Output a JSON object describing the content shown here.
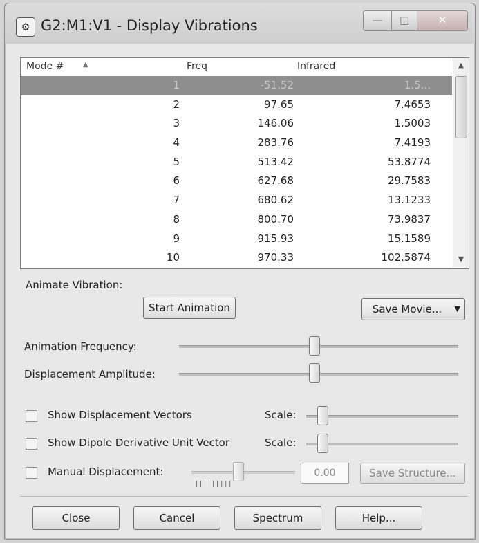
{
  "window": {
    "title": "G2:M1:V1 - Display Vibrations",
    "app_icon": "gaussview-app-icon"
  },
  "list": {
    "headers": [
      "Mode #",
      "Freq",
      "Infrared"
    ],
    "rows": [
      {
        "mode": "1",
        "freq": "-51.52",
        "ir": "1.5..."
      },
      {
        "mode": "2",
        "freq": "97.65",
        "ir": "7.4653"
      },
      {
        "mode": "3",
        "freq": "146.06",
        "ir": "1.5003"
      },
      {
        "mode": "4",
        "freq": "283.76",
        "ir": "7.4193"
      },
      {
        "mode": "5",
        "freq": "513.42",
        "ir": "53.8774"
      },
      {
        "mode": "6",
        "freq": "627.68",
        "ir": "29.7583"
      },
      {
        "mode": "7",
        "freq": "680.62",
        "ir": "13.1233"
      },
      {
        "mode": "8",
        "freq": "800.70",
        "ir": "73.9837"
      },
      {
        "mode": "9",
        "freq": "915.93",
        "ir": "15.1589"
      },
      {
        "mode": "10",
        "freq": "970.33",
        "ir": "102.5874"
      }
    ]
  },
  "animate": {
    "section_label": "Animate Vibration:",
    "start_button": "Start Animation",
    "save_movie_button": "Save Movie..."
  },
  "sliders": {
    "frequency_label": "Animation Frequency:",
    "frequency_level": 0.5,
    "amplitude_label": "Displacement Amplitude:",
    "amplitude_level": 0.5
  },
  "options": {
    "show_displacement_vectors": "Show Displacement Vectors",
    "show_dipole_vector": "Show Dipole Derivative Unit Vector",
    "manual_displacement": "Manual Displacement:",
    "scale_label": "Scale:",
    "manual_value": "0.00",
    "save_structure_button": "Save Structure..."
  },
  "footer": {
    "close": "Close",
    "cancel": "Cancel",
    "spectrum": "Spectrum",
    "help": "Help..."
  }
}
